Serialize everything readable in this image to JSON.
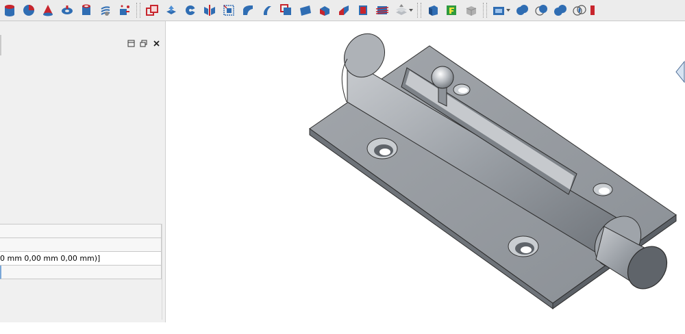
{
  "toolbar": {
    "groups": [
      {
        "name": "primitives",
        "icons": [
          "cylinder-icon",
          "sphere-icon",
          "cone-icon",
          "torus-icon",
          "tube-icon",
          "helix-icon",
          "create-primitives-icon"
        ]
      },
      {
        "name": "modify",
        "icons": [
          "mirror-icon",
          "extrude-icon",
          "revolve-icon",
          "mirror-plane-icon",
          "fillet-icon",
          "chamfer-icon",
          "make-face-icon",
          "ruled-surface-icon",
          "loft-icon",
          "sweep-icon",
          "section-icon",
          "cross-sections-icon",
          "offset-icon",
          "thickness-icon",
          "projection-icon",
          "compound-icon",
          "shape-builder-icon"
        ]
      },
      {
        "name": "boolean",
        "icons": [
          "boolean-icon",
          "cut-icon",
          "fuse-icon",
          "common-icon",
          "xor-icon"
        ]
      }
    ]
  },
  "property_rows": [
    "",
    "",
    "0 mm  0,00 mm  0,00 mm)]",
    ""
  ],
  "colors": {
    "accent_red": "#c8252d",
    "accent_blue": "#2f6db3",
    "model_gray": "#9aa0a7"
  }
}
